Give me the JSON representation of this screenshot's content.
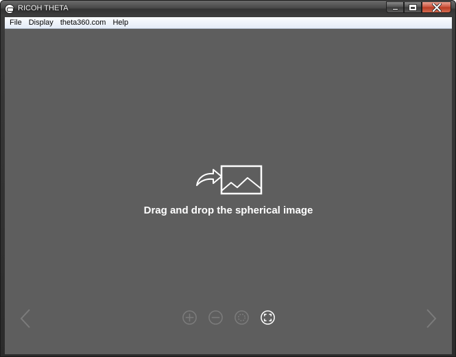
{
  "window": {
    "title": "RICOH THETA"
  },
  "menu": {
    "items": [
      "File",
      "Display",
      "theta360.com",
      "Help"
    ]
  },
  "viewer": {
    "drop_text": "Drag and drop the spherical image"
  },
  "toolbar": {
    "buttons": [
      {
        "icon": "zoom-in-icon",
        "enabled": false
      },
      {
        "icon": "zoom-out-icon",
        "enabled": false
      },
      {
        "icon": "rotate-icon",
        "enabled": false
      },
      {
        "icon": "fullscreen-icon",
        "enabled": true
      }
    ]
  },
  "colors": {
    "viewer_bg": "#5e5e5e",
    "icon_enabled": "#ffffff",
    "icon_disabled": "#7c7c7c"
  }
}
